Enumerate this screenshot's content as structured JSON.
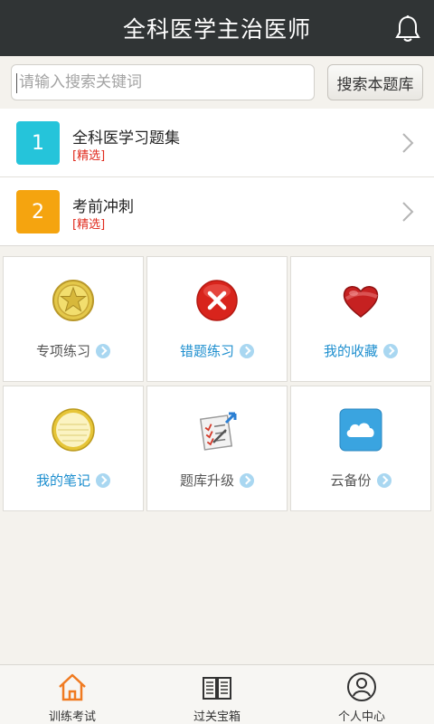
{
  "header": {
    "title": "全科医学主治医师",
    "bell_icon": "bell-icon"
  },
  "search": {
    "placeholder": "请输入搜索关键词",
    "button_label": "搜索本题库"
  },
  "list": [
    {
      "number": "1",
      "title": "全科医学习题集",
      "tag": "[精选]",
      "color": "#25c4da"
    },
    {
      "number": "2",
      "title": "考前冲刺",
      "tag": "[精选]",
      "color": "#f5a40f"
    }
  ],
  "grid": [
    {
      "label": "专项练习",
      "icon": "star-medal-icon",
      "label_color": "gray"
    },
    {
      "label": "错题练习",
      "icon": "red-x-icon",
      "label_color": "blue"
    },
    {
      "label": "我的收藏",
      "icon": "heart-icon",
      "label_color": "blue"
    },
    {
      "label": "我的笔记",
      "icon": "notepad-icon",
      "label_color": "blue"
    },
    {
      "label": "题库升级",
      "icon": "checklist-upgrade-icon",
      "label_color": "gray"
    },
    {
      "label": "云备份",
      "icon": "cloud-icon",
      "label_color": "gray"
    }
  ],
  "tabbar": [
    {
      "label": "训练考试",
      "icon": "home-icon",
      "active": true
    },
    {
      "label": "过关宝箱",
      "icon": "book-icon",
      "active": false
    },
    {
      "label": "个人中心",
      "icon": "person-icon",
      "active": false
    }
  ],
  "colors": {
    "header_bg": "#303435",
    "accent_blue": "#1e8fcf",
    "tag_red": "#e02a1d",
    "tab_active": "#f07a20"
  }
}
